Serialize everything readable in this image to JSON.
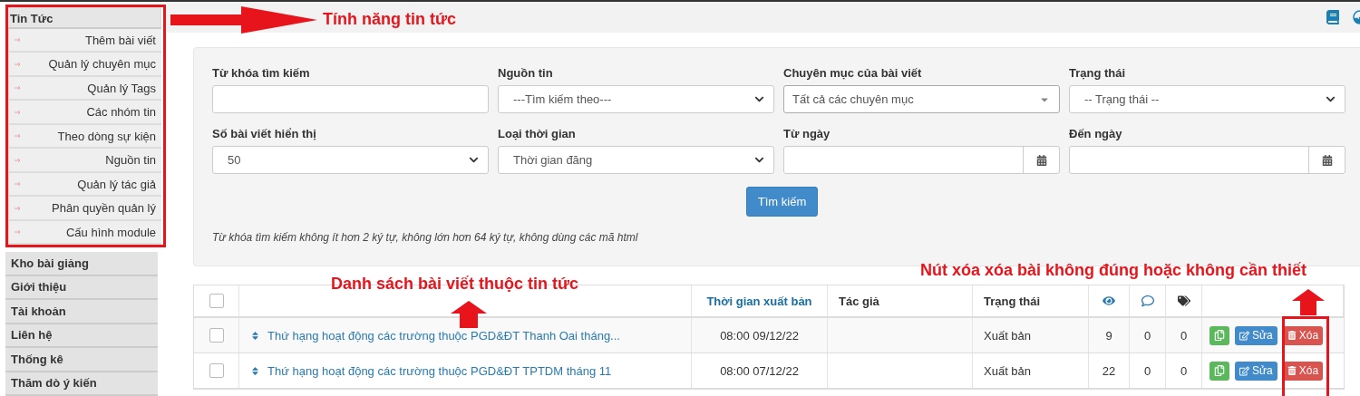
{
  "sidebar": {
    "section": {
      "label": "Tin Tức",
      "expanded": true,
      "children": [
        {
          "label": "Thêm bài viết"
        },
        {
          "label": "Quản lý chuyên mục"
        },
        {
          "label": "Quản lý Tags"
        },
        {
          "label": "Các nhóm tin"
        },
        {
          "label": "Theo dòng sự kiện"
        },
        {
          "label": "Nguồn tin"
        },
        {
          "label": "Quản lý tác giả"
        },
        {
          "label": "Phân quyền quản lý"
        },
        {
          "label": "Cấu hình module"
        }
      ]
    },
    "items": [
      {
        "label": "Kho bài giảng"
      },
      {
        "label": "Giới thiệu"
      },
      {
        "label": "Tài khoản"
      },
      {
        "label": "Liên hệ"
      },
      {
        "label": "Thống kê"
      },
      {
        "label": "Thăm dò ý kiến"
      }
    ]
  },
  "filters": [
    {
      "kind": "text",
      "label": "Từ khóa tìm kiếm"
    },
    {
      "kind": "select",
      "label": "Nguồn tin",
      "value": "---Tìm kiếm theo---"
    },
    {
      "kind": "combo",
      "label": "Chuyên mục của bài viết",
      "value": "Tất cả các chuyên mục"
    },
    {
      "kind": "select",
      "label": "Trạng thái",
      "value": "-- Trạng thái --"
    },
    {
      "kind": "select",
      "label": "Số bài viết hiển thị",
      "value": "50"
    },
    {
      "kind": "select",
      "label": "Loại thời gian",
      "value": "Thời gian đăng"
    },
    {
      "kind": "date",
      "label": "Từ ngày"
    },
    {
      "kind": "date",
      "label": "Đến ngày"
    }
  ],
  "search_button": "Tìm kiếm",
  "hint": "Từ khóa tìm kiếm không ít hơn 2 ký tự, không lớn hơn 64 ký tự, không dùng các mã html",
  "table": {
    "all_selected": false,
    "columns": [
      "Thời gian xuất bản",
      "Tác giả",
      "Trạng thái"
    ],
    "rows": [
      {
        "selected": false,
        "title": "Thứ hạng hoạt động các trường thuộc PGD&ĐT Thanh Oai tháng...",
        "time": "08:00 09/12/22",
        "author": "",
        "status": "Xuất bản",
        "views": "9",
        "comments": "0",
        "tags": "0",
        "edit": "Sửa",
        "delete": "Xóa"
      },
      {
        "selected": false,
        "title": "Thứ hạng hoạt động các trường thuộc PGD&ĐT TPTDM tháng 11",
        "time": "08:00 07/12/22",
        "author": "",
        "status": "Xuất bản",
        "views": "22",
        "comments": "0",
        "tags": "0",
        "edit": "Sửa",
        "delete": "Xóa"
      }
    ]
  },
  "annotations": {
    "features": "Tính năng tin tức",
    "list": "Danh sách bài viết thuộc tin tức",
    "delete": "Nút xóa xóa bài không đúng hoặc không cần thiết"
  }
}
